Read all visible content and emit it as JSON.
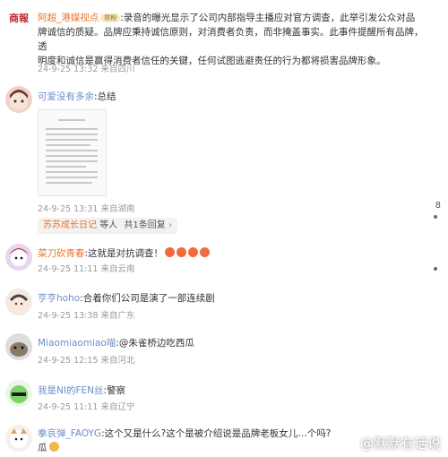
{
  "comments": [
    {
      "name": "阿超_港媒视点",
      "badge": "铁粉",
      "text_lines": [
        ":录音的曝光显示了公司内部指导主播应对官方调查，此举引发公众对品",
        "牌诚信的质疑。品牌应秉持诚信原则，对消费者负责，而非掩盖事实。此事件提醒所有品牌，透",
        "明度和诚信是赢得消费者信任的关键，任何试图逃避责任的行为都将损害品牌形象。"
      ],
      "meta": "24-9-25 13:32 来自四川"
    },
    {
      "name": "可爱没有多余",
      "text": ":总结",
      "meta": "24-9-25 13:31 来自湖南",
      "reply_by": "苏苏成长日记",
      "reply_suffix": "等人",
      "reply_count": "共1条回复",
      "side_count": "8"
    },
    {
      "name": "菜刀砍青春",
      "text": ":这就是对抗调查！",
      "meta": "24-9-25 11:11 来自云南"
    },
    {
      "name": "亨亨hoho",
      "text": ":合着你们公司是演了一部连续剧",
      "meta": "24-9-25 13:38 来自广东"
    },
    {
      "name": "Miaomiaomiao喵",
      "text": ":@朱雀桥边吃西瓜",
      "meta": "24-9-25 12:15 来自河北"
    },
    {
      "name": "我是NI的FEN丝",
      "text": ":警察",
      "meta": "24-9-25 11:11 来自辽宁"
    },
    {
      "name": "拳哀弹_FAOYG",
      "text_lines": [
        ":这个又是什么?这个是被介绍说是品牌老板女儿…个吗?",
        "瓜"
      ]
    }
  ],
  "avatar_logo_text": "商報",
  "watermark": "@默默有话说"
}
